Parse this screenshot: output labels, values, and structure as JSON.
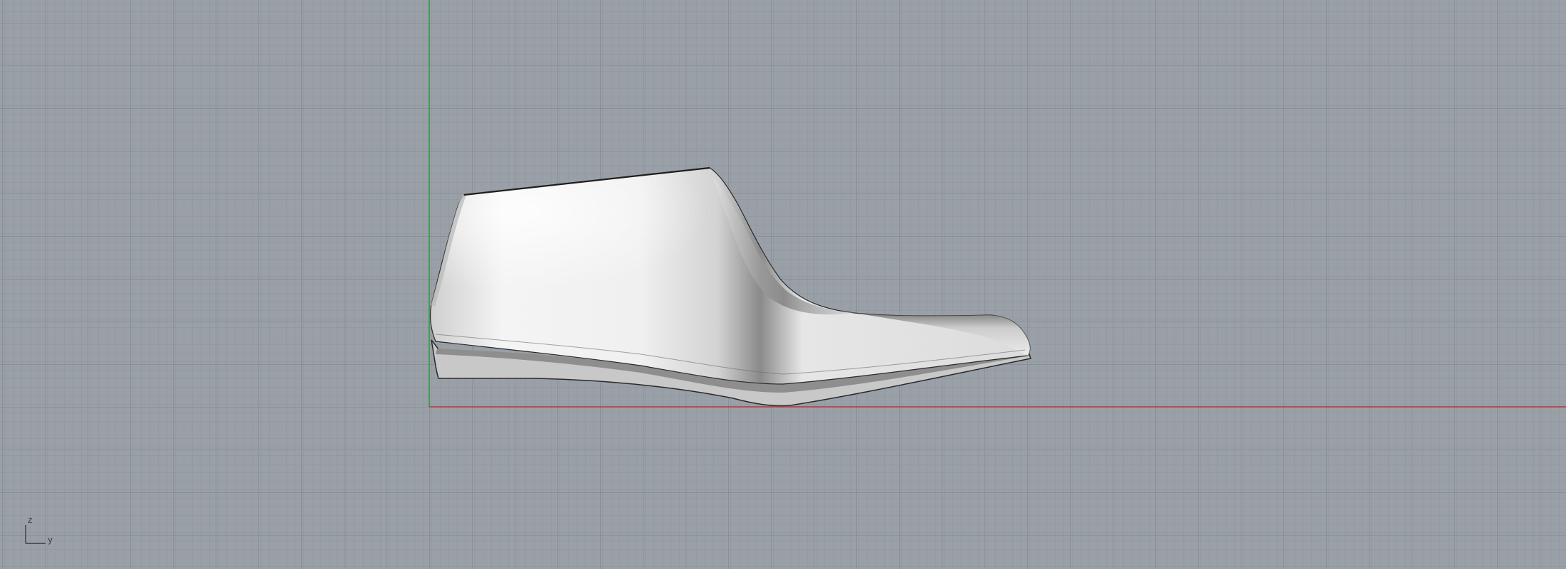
{
  "viewport": {
    "background_color": "#9aa0a7",
    "grid_minor_color": "#8d939a",
    "grid_major_color": "#80868d",
    "x_axis_color": "#c0313a",
    "y_axis_color": "#2e9a3c"
  },
  "model": {
    "object": "shoe-last",
    "shading": "rendered-grey"
  },
  "axis_indicator": {
    "vertical_label": "z",
    "horizontal_label": "y"
  }
}
